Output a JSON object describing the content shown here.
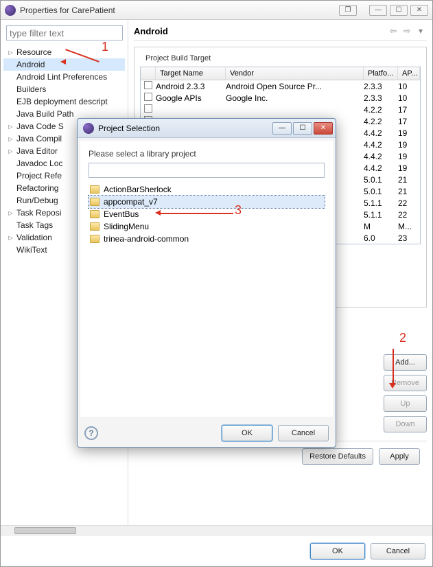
{
  "window": {
    "title": "Properties for CarePatient"
  },
  "filter_placeholder": "type filter text",
  "tree": {
    "items": [
      {
        "label": "Resource",
        "expandable": true
      },
      {
        "label": "Android",
        "expandable": false,
        "selected": true
      },
      {
        "label": "Android Lint Preferences",
        "expandable": false
      },
      {
        "label": "Builders",
        "expandable": false
      },
      {
        "label": "EJB deployment descript",
        "expandable": false
      },
      {
        "label": "Java Build Path",
        "expandable": false
      },
      {
        "label": "Java Code S",
        "expandable": true
      },
      {
        "label": "Java Compil",
        "expandable": true
      },
      {
        "label": "Java Editor",
        "expandable": true
      },
      {
        "label": "Javadoc Loc",
        "expandable": false
      },
      {
        "label": "Project Refe",
        "expandable": false
      },
      {
        "label": "Refactoring",
        "expandable": false
      },
      {
        "label": "Run/Debug",
        "expandable": false
      },
      {
        "label": "Task Reposi",
        "expandable": true
      },
      {
        "label": "Task Tags",
        "expandable": false
      },
      {
        "label": "Validation",
        "expandable": true
      },
      {
        "label": "WikiText",
        "expandable": false
      }
    ]
  },
  "right": {
    "heading": "Android",
    "group_title": "Project Build Target",
    "columns": {
      "name": "Target Name",
      "vendor": "Vendor",
      "platform": "Platfo...",
      "api": "AP..."
    },
    "rows": [
      {
        "name": "Android 2.3.3",
        "vendor": "Android Open Source Pr...",
        "platform": "2.3.3",
        "api": "10"
      },
      {
        "name": "Google APIs",
        "vendor": "Google Inc.",
        "platform": "2.3.3",
        "api": "10"
      },
      {
        "name": "",
        "vendor": "",
        "platform": "4.2.2",
        "api": "17"
      },
      {
        "name": "",
        "vendor": "",
        "platform": "4.2.2",
        "api": "17"
      },
      {
        "name": "",
        "vendor": "",
        "platform": "4.4.2",
        "api": "19"
      },
      {
        "name": "",
        "vendor": "",
        "platform": "4.4.2",
        "api": "19"
      },
      {
        "name": "",
        "vendor": "",
        "platform": "4.4.2",
        "api": "19"
      },
      {
        "name": "",
        "vendor": "",
        "platform": "4.4.2",
        "api": "19"
      },
      {
        "name": "",
        "vendor": "",
        "platform": "5.0.1",
        "api": "21"
      },
      {
        "name": "",
        "vendor": "",
        "platform": "5.0.1",
        "api": "21"
      },
      {
        "name": "",
        "vendor": "",
        "platform": "5.1.1",
        "api": "22"
      },
      {
        "name": "",
        "vendor": "",
        "platform": "5.1.1",
        "api": "22"
      },
      {
        "name": "",
        "vendor": "",
        "platform": "M",
        "api": "M..."
      },
      {
        "name": "",
        "vendor": "",
        "platform": "6.0",
        "api": "23"
      }
    ],
    "buttons": {
      "add": "Add...",
      "remove": "Remove",
      "up": "Up",
      "down": "Down"
    },
    "restore": "Restore Defaults",
    "apply": "Apply",
    "ok": "OK",
    "cancel": "Cancel"
  },
  "dialog": {
    "title": "Project Selection",
    "prompt": "Please select a library project",
    "items": [
      {
        "label": "ActionBarSherlock"
      },
      {
        "label": "appcompat_v7",
        "selected": true
      },
      {
        "label": "EventBus"
      },
      {
        "label": "SlidingMenu"
      },
      {
        "label": "trinea-android-common"
      }
    ],
    "ok": "OK",
    "cancel": "Cancel"
  },
  "annotations": {
    "one": "1",
    "two": "2",
    "three": "3"
  }
}
